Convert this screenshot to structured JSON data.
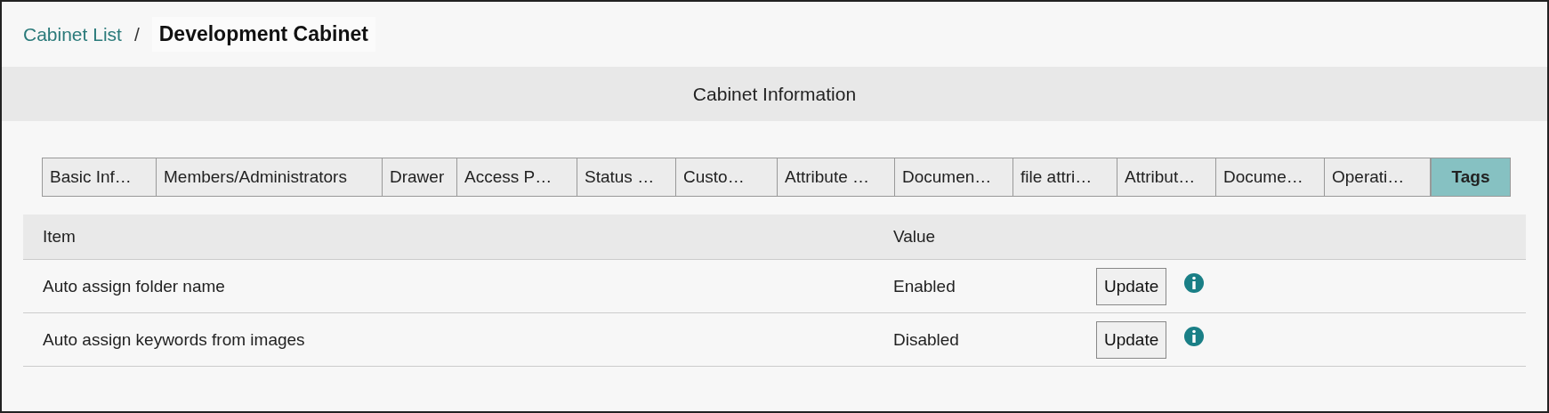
{
  "breadcrumb": {
    "parent": "Cabinet List",
    "separator": "/",
    "current": "Development Cabinet"
  },
  "section_title": "Cabinet Information",
  "tabs": [
    {
      "label": "Basic Inf…",
      "selected": false
    },
    {
      "label": "Members/Administrators",
      "selected": false
    },
    {
      "label": "Drawer",
      "selected": false
    },
    {
      "label": "Access P…",
      "selected": false
    },
    {
      "label": "Status …",
      "selected": false
    },
    {
      "label": "Custo…",
      "selected": false
    },
    {
      "label": "Attribute …",
      "selected": false
    },
    {
      "label": "Documen…",
      "selected": false
    },
    {
      "label": "file attri…",
      "selected": false
    },
    {
      "label": "Attribut…",
      "selected": false
    },
    {
      "label": "Docume…",
      "selected": false
    },
    {
      "label": "Operati…",
      "selected": false
    },
    {
      "label": "Tags",
      "selected": true
    }
  ],
  "table": {
    "columns": [
      "Item",
      "Value"
    ],
    "rows": [
      {
        "item": "Auto assign folder name",
        "value": "Enabled",
        "button": "Update"
      },
      {
        "item": "Auto assign keywords from images",
        "value": "Disabled",
        "button": "Update"
      }
    ]
  }
}
